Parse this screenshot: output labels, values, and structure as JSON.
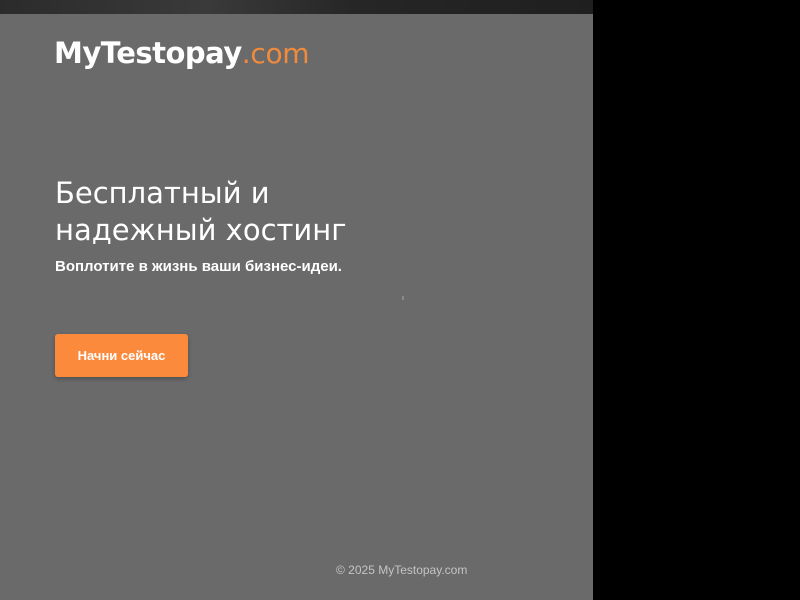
{
  "logo": {
    "name": "MyTestopay",
    "domain": ".com"
  },
  "hero": {
    "headline_line1": "Бесплатный и",
    "headline_line2": "надежный хостинг",
    "subheadline": "Воплотите в жизнь ваши бизнес-идеи.",
    "cta_label": "Начни сейчас"
  },
  "footer": {
    "copyright": "© 2025 MyTestopay.com"
  },
  "colors": {
    "panel_background": "#6a6a6a",
    "accent": "#fb8a3c",
    "outside_background": "#000000"
  }
}
